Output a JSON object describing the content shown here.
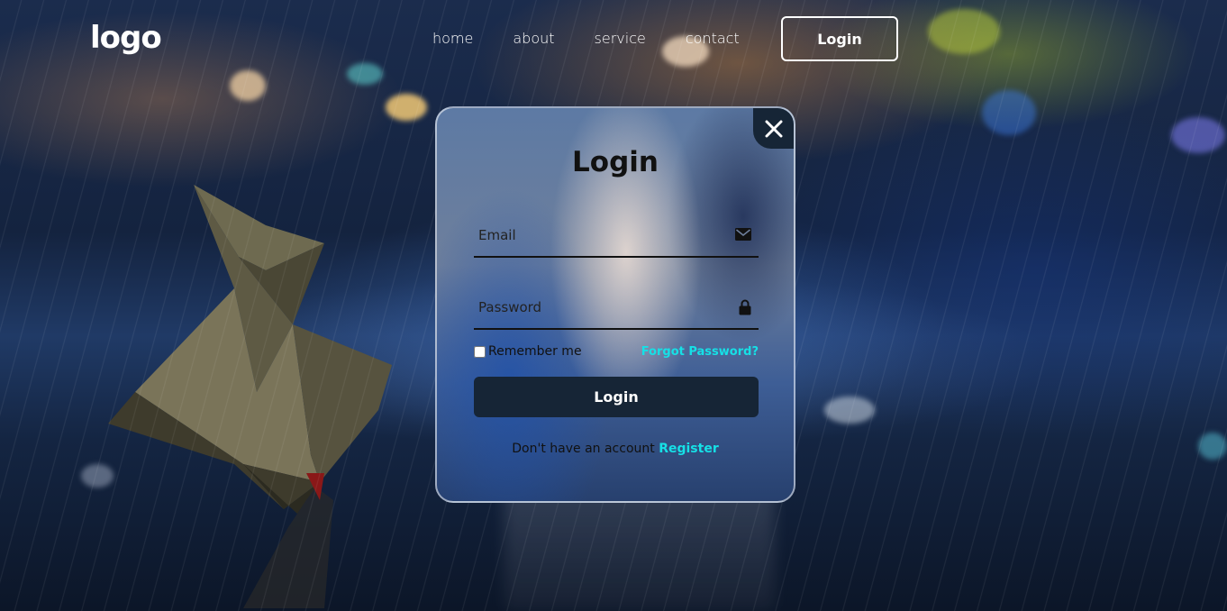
{
  "header": {
    "logo": "logo",
    "nav": [
      "home",
      "about",
      "service",
      "contact"
    ],
    "login_button": "Login"
  },
  "modal": {
    "title": "Login",
    "close_icon": "close-icon",
    "email_placeholder": "Email",
    "email_icon": "mail-icon",
    "password_placeholder": "Password",
    "password_icon": "lock-icon",
    "remember_label": "Remember me",
    "forgot_label": "Forgot Password?",
    "submit_label": "Login",
    "register_prompt": "Don't have an account",
    "register_link": "Register"
  },
  "colors": {
    "accent": "#16e0e6",
    "button_dark": "#162536"
  }
}
